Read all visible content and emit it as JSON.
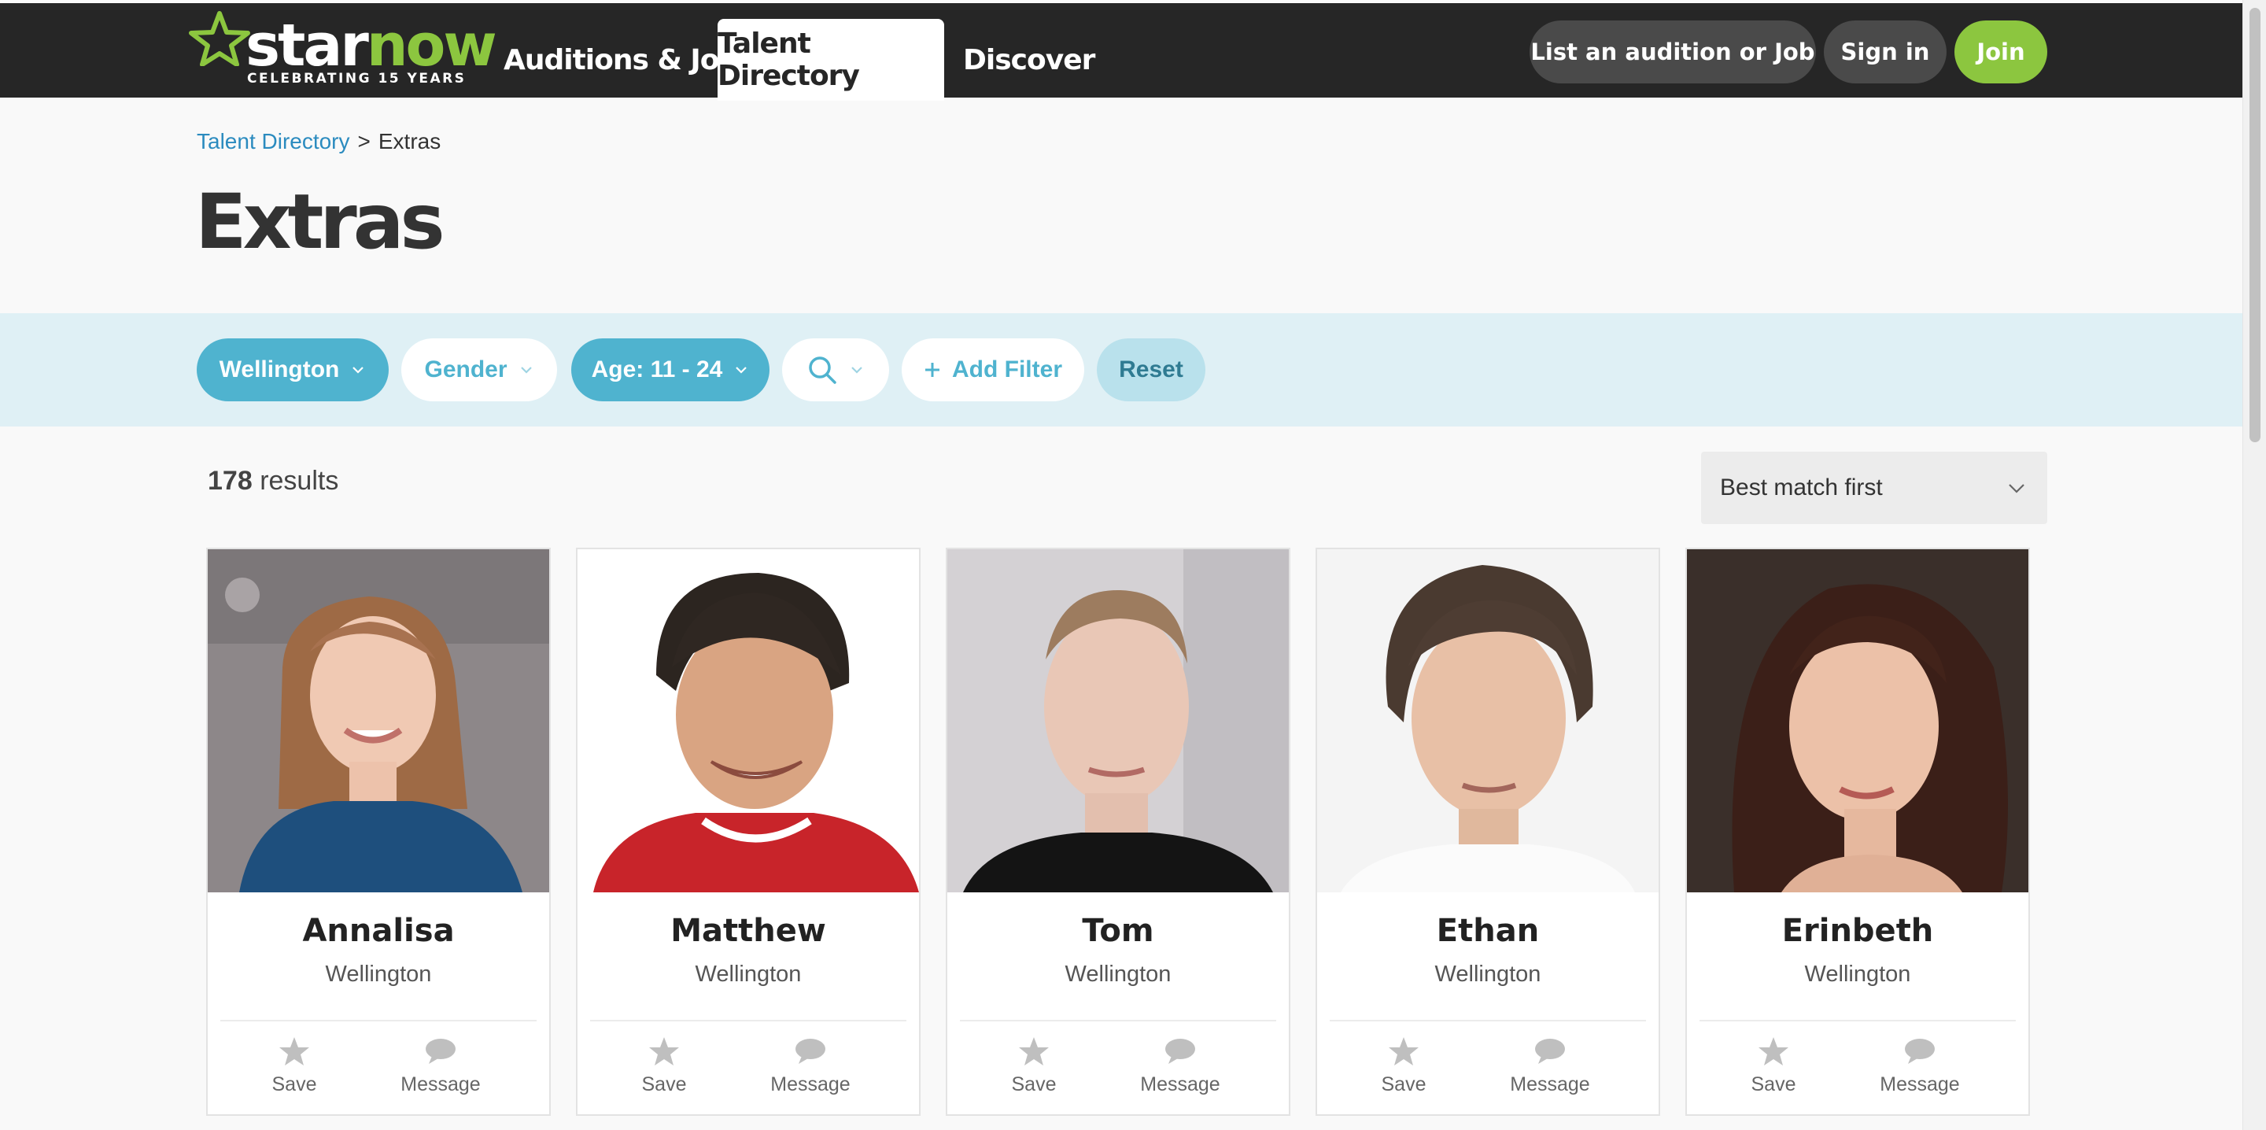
{
  "header": {
    "logo": {
      "word_a": "star",
      "word_b": "now",
      "tagline": "CELEBRATING 15 YEARS"
    },
    "nav": [
      {
        "label": "Auditions & Jobs"
      },
      {
        "label": "Talent Directory"
      },
      {
        "label": "Discover"
      }
    ],
    "buttons": {
      "list": "List an audition or Job",
      "signin": "Sign in",
      "join": "Join"
    }
  },
  "breadcrumb": {
    "link": "Talent Directory",
    "separator": ">",
    "current": "Extras"
  },
  "page_title": "Extras",
  "filters": {
    "location": "Wellington",
    "gender": "Gender",
    "age": "Age: 11 - 24",
    "add_filter": "Add Filter",
    "reset": "Reset"
  },
  "results": {
    "count": "178",
    "label": "results"
  },
  "sort": {
    "selected": "Best match first"
  },
  "cards": [
    {
      "name": "Annalisa",
      "location": "Wellington",
      "save": "Save",
      "message": "Message"
    },
    {
      "name": "Matthew",
      "location": "Wellington",
      "save": "Save",
      "message": "Message"
    },
    {
      "name": "Tom",
      "location": "Wellington",
      "save": "Save",
      "message": "Message"
    },
    {
      "name": "Ethan",
      "location": "Wellington",
      "save": "Save",
      "message": "Message"
    },
    {
      "name": "Erinbeth",
      "location": "Wellington",
      "save": "Save",
      "message": "Message"
    }
  ],
  "colors": {
    "header_bg": "#262626",
    "brand_green": "#8cc63f",
    "filter_band": "#dff0f5",
    "chip_filled": "#4fb3cf",
    "link_blue": "#2b8bbf"
  },
  "icons": [
    "star-logo-icon",
    "chevron-down-icon",
    "search-icon",
    "plus-icon",
    "star-icon",
    "speech-bubble-icon"
  ]
}
